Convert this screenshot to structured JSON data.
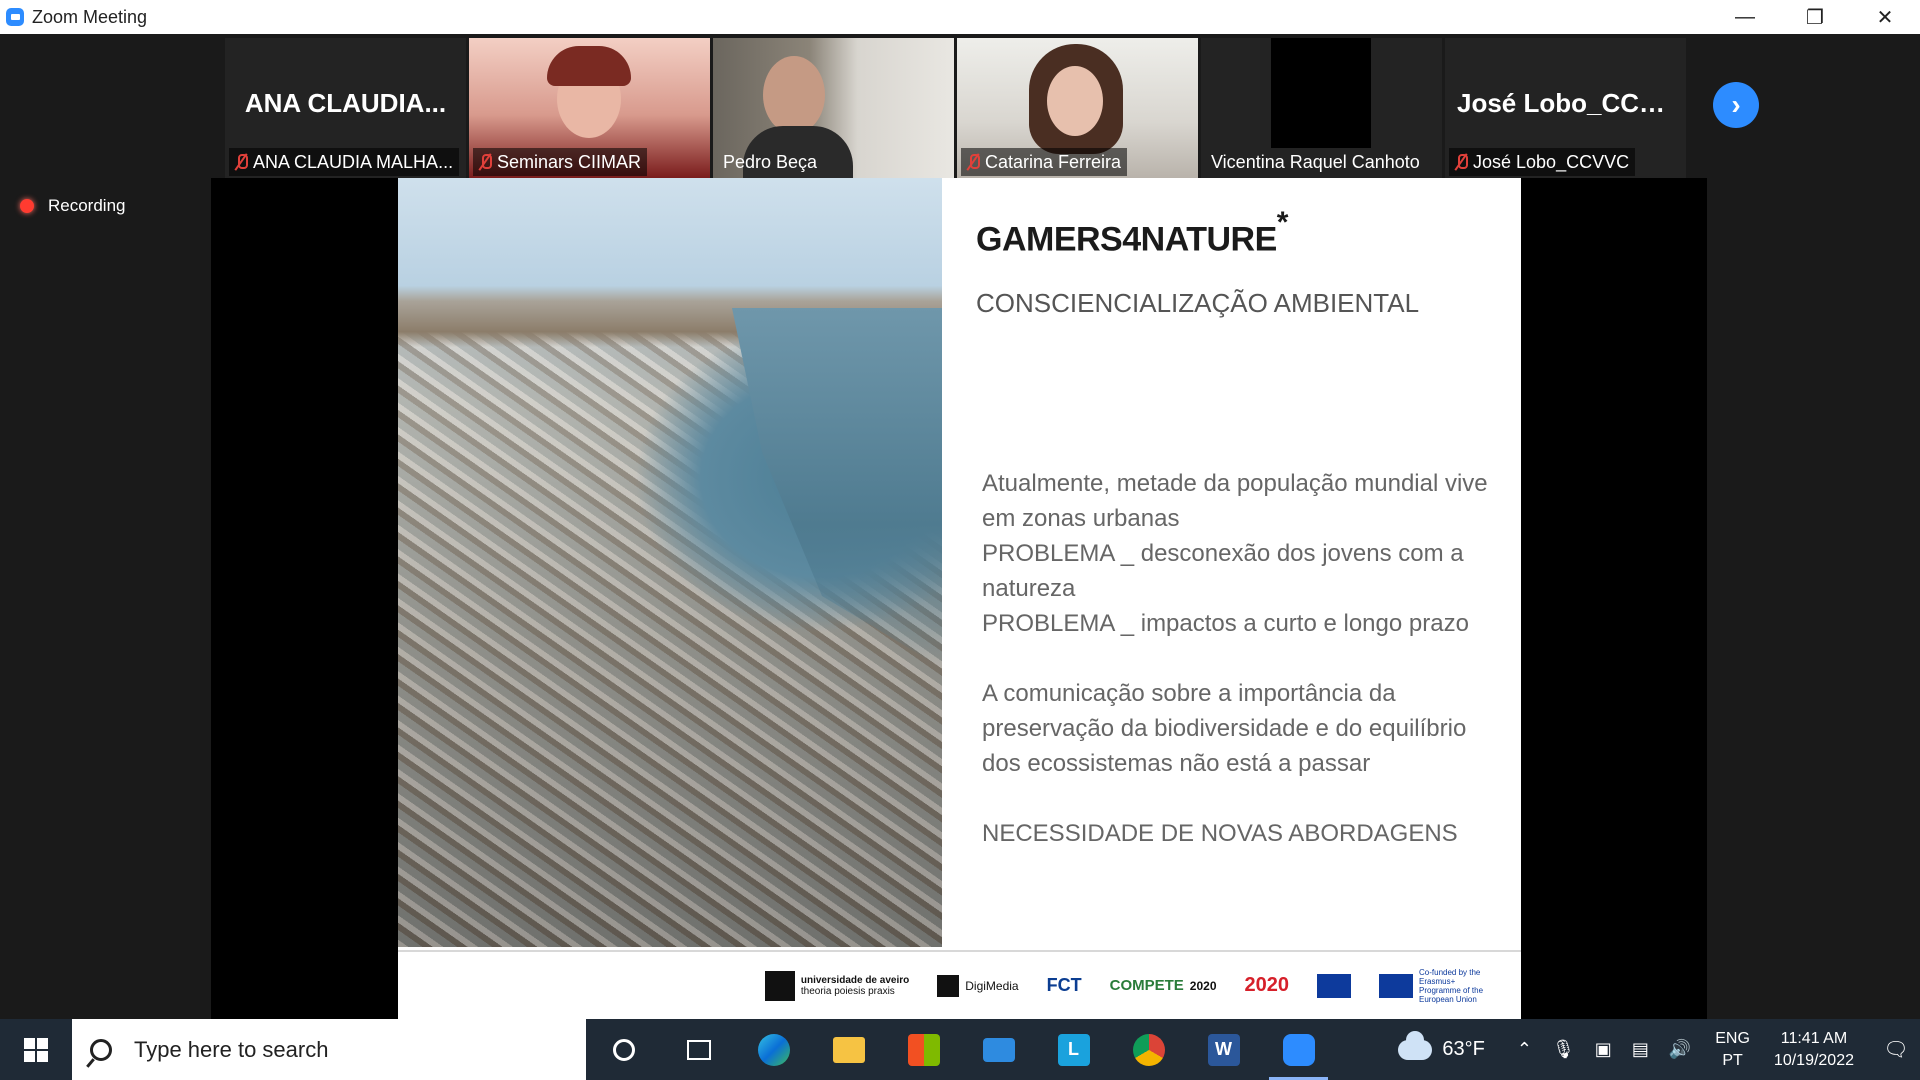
{
  "window": {
    "title": "Zoom Meeting"
  },
  "participants": [
    {
      "big_name": "ANA  CLAUDIA...",
      "label": "ANA CLAUDIA MALHA...",
      "muted": true,
      "video": false
    },
    {
      "label": "Seminars CIIMAR",
      "muted": true,
      "video": true
    },
    {
      "label": "Pedro Beça",
      "muted": false,
      "video": true,
      "active": true
    },
    {
      "label": "Catarina Ferreira",
      "muted": true,
      "video": true
    },
    {
      "label": "Vicentina Raquel Canhoto",
      "muted": false,
      "video": false
    },
    {
      "big_name": "José Lobo_CCVVC",
      "label": "José Lobo_CCVVC",
      "muted": true,
      "video": false
    }
  ],
  "recording": {
    "label": "Recording"
  },
  "slide": {
    "title": "GAMERS4NATURE",
    "title_mark": "*",
    "subtitle": "CONSCIENCIALIZAÇÃO AMBIENTAL",
    "body": [
      "Atualmente, metade da população mundial vive em zonas urbanas",
      "PROBLEMA _ desconexão dos jovens com a natureza",
      "PROBLEMA _ impactos a curto e longo prazo",
      "A comunicação sobre a importância da preservação da biodiversidade e do equilíbrio dos ecossistemas não está a passar",
      "NECESSIDADE DE NOVAS ABORDAGENS"
    ],
    "logos": {
      "ua_line1": "universidade de aveiro",
      "ua_line2": "theoria poiesis praxis",
      "digimedia": "DigiMedia",
      "fct": "FCT",
      "compete": "COMPETE",
      "compete_year": "2020",
      "portugal": "2020",
      "erasmus": "Co-funded by the Erasmus+ Programme of the European Union"
    }
  },
  "taskbar": {
    "search_placeholder": "Type here to search",
    "weather": "63°F",
    "lang_top": "ENG",
    "lang_bottom": "PT",
    "time": "11:41 AM",
    "date": "10/19/2022"
  },
  "colors": {
    "zoom_blue": "#2d8cff",
    "active_speaker": "#7fd36a",
    "muted_red": "#e0403a",
    "taskbar": "#1f2a36"
  }
}
